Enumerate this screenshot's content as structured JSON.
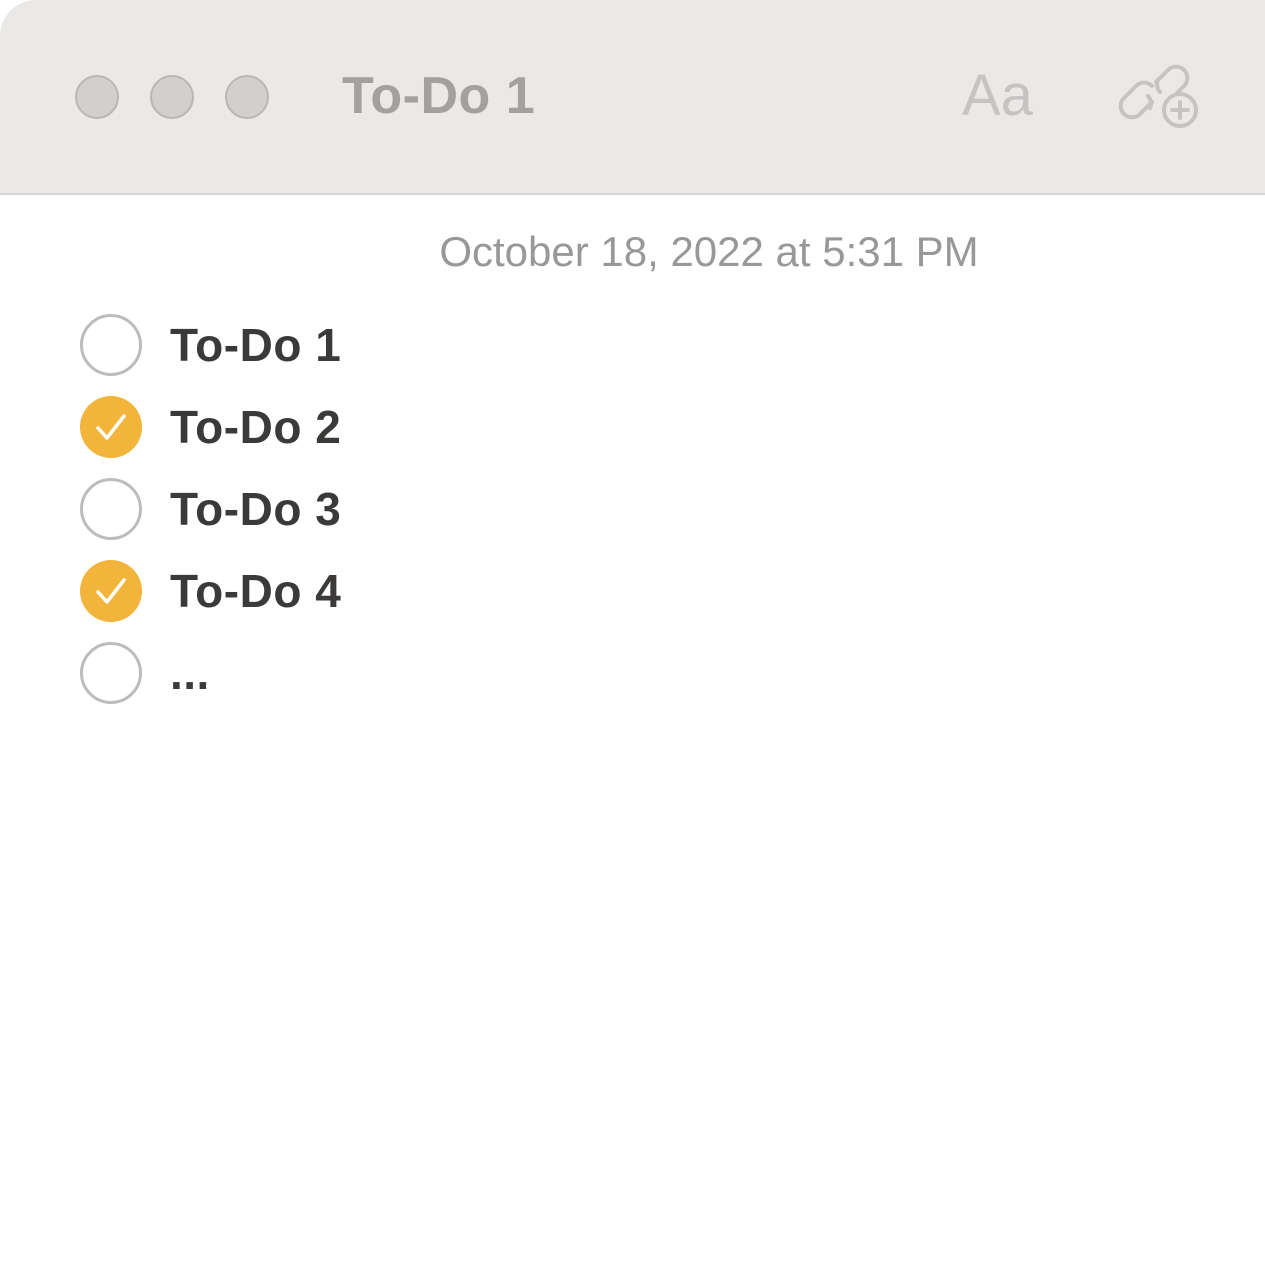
{
  "window": {
    "title": "To-Do 1",
    "format_label": "Aa",
    "collaborate_icon": "link-plus-icon"
  },
  "note": {
    "date": "October 18, 2022 at 5:31 PM",
    "items": [
      {
        "label": "To-Do 1",
        "checked": false
      },
      {
        "label": "To-Do 2",
        "checked": true
      },
      {
        "label": "To-Do 3",
        "checked": false
      },
      {
        "label": "To-Do 4",
        "checked": true
      },
      {
        "label": "...",
        "checked": false
      }
    ]
  },
  "colors": {
    "accent": "#f2b43a",
    "titlebar": "#ebe9e8",
    "text": "#3b3a39"
  }
}
